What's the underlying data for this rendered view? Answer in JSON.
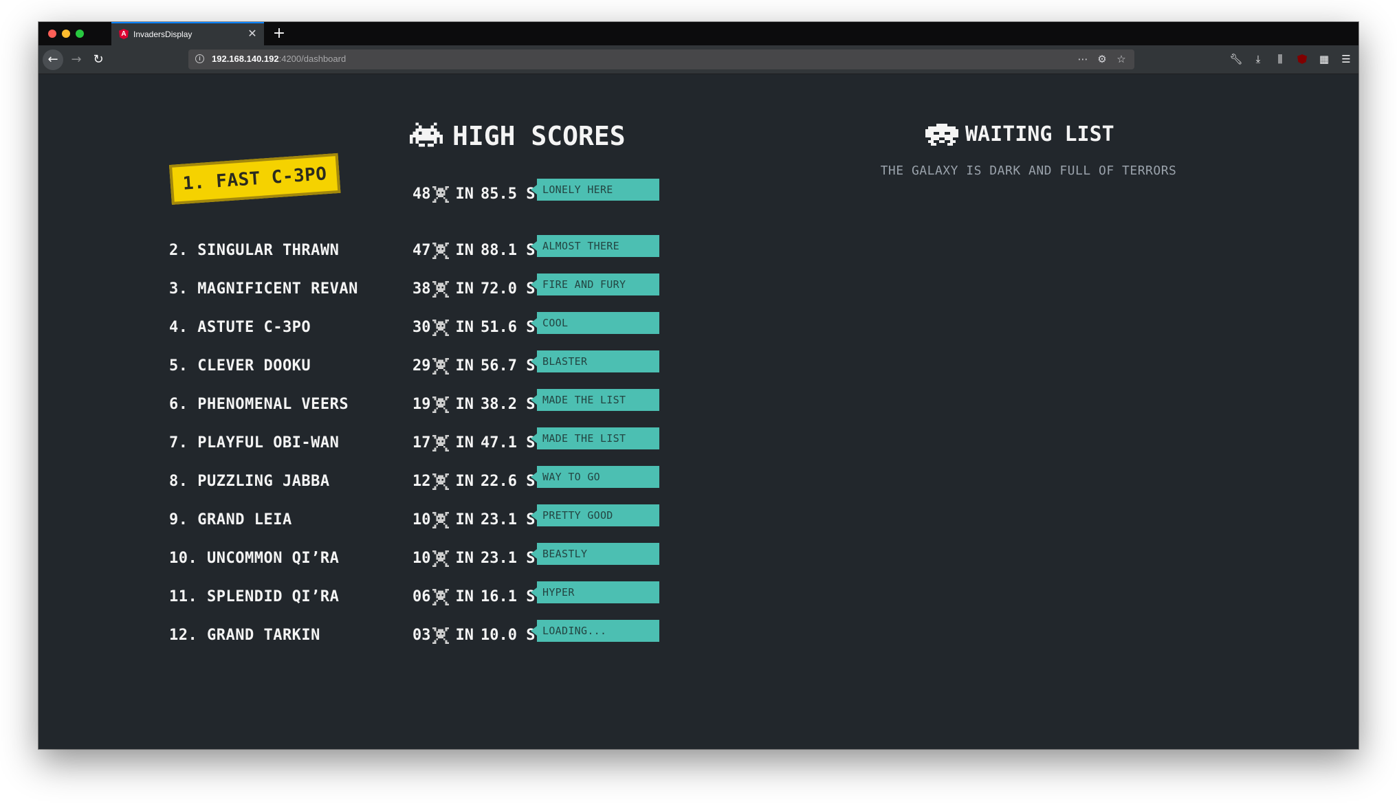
{
  "browser": {
    "tab_title": "InvadersDisplay",
    "url_host": "192.168.140.192",
    "url_path": ":4200/dashboard",
    "tab_favicon_letter": "A"
  },
  "high_scores": {
    "title": "HIGH SCORES",
    "in_label": "IN",
    "entries": [
      {
        "player": "1. FAST C-3PO",
        "score": "48",
        "time": "85.5 S",
        "badge": "LONELY HERE"
      },
      {
        "player": "2. SINGULAR THRAWN",
        "score": "47",
        "time": "88.1 S",
        "badge": "ALMOST THERE"
      },
      {
        "player": "3. MAGNIFICENT REVAN",
        "score": "38",
        "time": "72.0 S",
        "badge": "FIRE AND FURY"
      },
      {
        "player": "4. ASTUTE C-3PO",
        "score": "30",
        "time": "51.6 S",
        "badge": "COOL"
      },
      {
        "player": "5. CLEVER DOOKU",
        "score": "29",
        "time": "56.7 S",
        "badge": "BLASTER"
      },
      {
        "player": "6. PHENOMENAL VEERS",
        "score": "19",
        "time": "38.2 S",
        "badge": "MADE THE LIST"
      },
      {
        "player": "7. PLAYFUL OBI-WAN",
        "score": "17",
        "time": "47.1 S",
        "badge": "MADE THE LIST"
      },
      {
        "player": "8. PUZZLING JABBA",
        "score": "12",
        "time": "22.6 S",
        "badge": "WAY TO GO"
      },
      {
        "player": "9. GRAND LEIA",
        "score": "10",
        "time": "23.1 S",
        "badge": "PRETTY GOOD"
      },
      {
        "player": "10. UNCOMMON QI’RA",
        "score": "10",
        "time": "23.1 S",
        "badge": "BEASTLY"
      },
      {
        "player": "11. SPLENDID QI’RA",
        "score": "06",
        "time": "16.1 S",
        "badge": "HYPER"
      },
      {
        "player": "12. GRAND TARKIN",
        "score": "03",
        "time": "10.0 S",
        "badge": "LOADING..."
      }
    ]
  },
  "waiting_list": {
    "title": "WAITING LIST",
    "subtitle": "THE GALAXY IS DARK AND FULL OF TERRORS"
  },
  "colors": {
    "background": "#22272c",
    "first_place_highlight": "#f5d200",
    "badge": "#4cbfb2"
  }
}
